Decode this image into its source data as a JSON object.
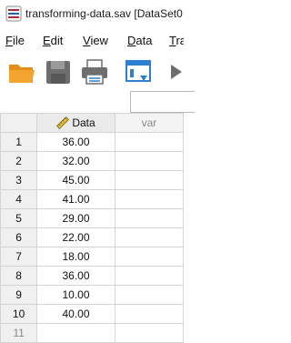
{
  "window": {
    "title": "transforming-data.sav [DataSet0"
  },
  "menu": {
    "items": [
      {
        "accel": "F",
        "rest": "ile"
      },
      {
        "accel": "E",
        "rest": "dit"
      },
      {
        "accel": "V",
        "rest": "iew"
      },
      {
        "accel": "D",
        "rest": "ata"
      },
      {
        "accel": "T",
        "rest": "ra"
      }
    ]
  },
  "toolbar": {
    "icons": [
      "open-folder-icon",
      "save-icon",
      "print-icon",
      "dialog-recall-icon",
      "undo-icon"
    ]
  },
  "grid": {
    "columns": [
      {
        "name": "Data",
        "icon": "scale-ruler-icon"
      },
      {
        "name": "var"
      }
    ],
    "rows": [
      {
        "num": "1",
        "value": "36.00"
      },
      {
        "num": "2",
        "value": "32.00"
      },
      {
        "num": "3",
        "value": "45.00"
      },
      {
        "num": "4",
        "value": "41.00"
      },
      {
        "num": "5",
        "value": "29.00"
      },
      {
        "num": "6",
        "value": "22.00"
      },
      {
        "num": "7",
        "value": "18.00"
      },
      {
        "num": "8",
        "value": "36.00"
      },
      {
        "num": "9",
        "value": "10.00"
      },
      {
        "num": "10",
        "value": "40.00"
      },
      {
        "num": "11",
        "value": ""
      }
    ]
  },
  "colors": {
    "folder": "#f3a530",
    "save": "#6e6e6e",
    "dialog_recall": "#2f7fd0",
    "app_icon": "#b02a37"
  }
}
